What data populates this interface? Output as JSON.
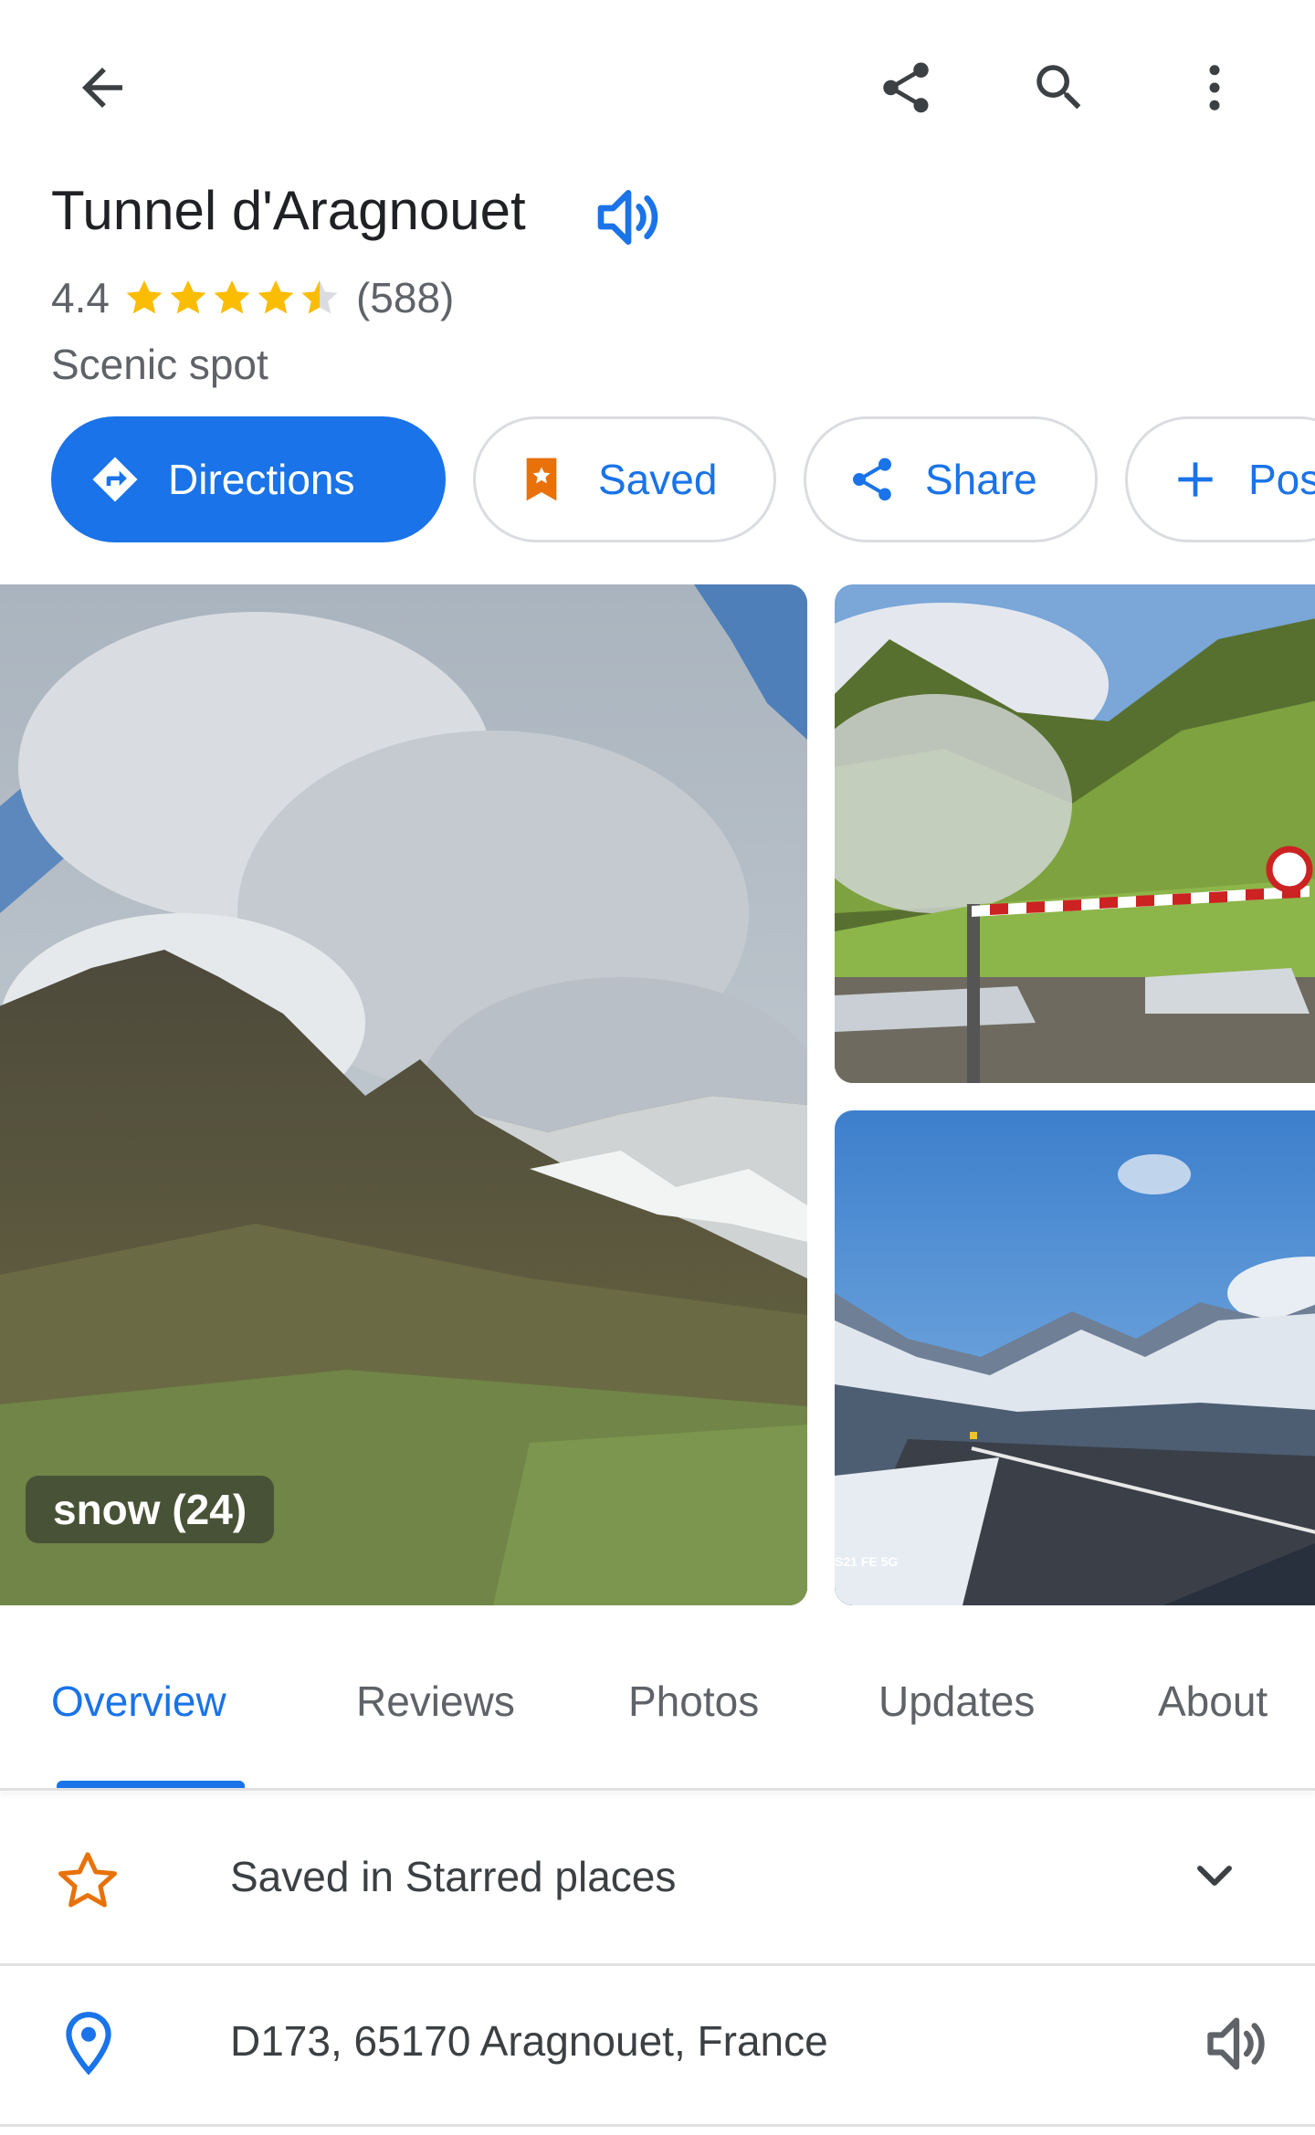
{
  "header": {
    "back_icon": "arrow-back-icon",
    "share_icon": "share-icon",
    "search_icon": "search-icon",
    "more_icon": "more-vert-icon"
  },
  "place": {
    "name": "Tunnel d'Aragnouet",
    "rating": "4.4",
    "rating_value": 4.4,
    "reviews_count": "(588)",
    "category": "Scenic spot"
  },
  "actions": {
    "directions_label": "Directions",
    "saved_label": "Saved",
    "share_label": "Share",
    "post_label": "Pos"
  },
  "photos": {
    "main_label": "snow (24)",
    "watermark": "S21 FE 5G"
  },
  "tabs": [
    {
      "label": "Overview",
      "active": true
    },
    {
      "label": "Reviews",
      "active": false
    },
    {
      "label": "Photos",
      "active": false
    },
    {
      "label": "Updates",
      "active": false
    },
    {
      "label": "About",
      "active": false
    }
  ],
  "info": {
    "saved_in": "Saved in Starred places",
    "address": "D173, 65170 Aragnouet, France"
  },
  "colors": {
    "accent": "#1a73e8",
    "star": "#fbbc04",
    "saved_orange": "#e8710a"
  }
}
